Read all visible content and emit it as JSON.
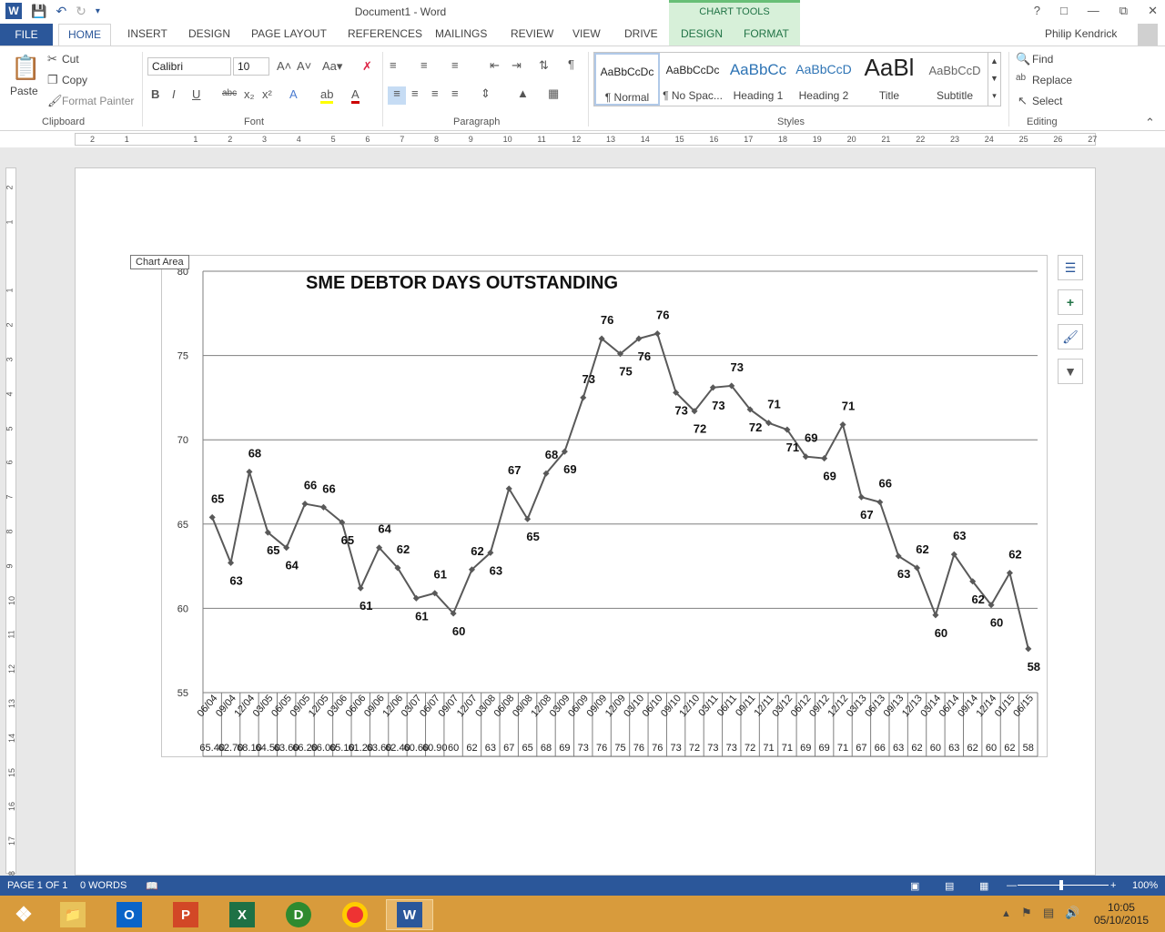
{
  "app": {
    "title": "Document1 - Word",
    "chart_tools": "CHART TOOLS",
    "user": "Philip Kendrick",
    "tabs": [
      "FILE",
      "HOME",
      "INSERT",
      "DESIGN",
      "PAGE LAYOUT",
      "REFERENCES",
      "MAILINGS",
      "REVIEW",
      "VIEW",
      "DRIVE",
      "DESIGN",
      "FORMAT"
    ]
  },
  "ribbon": {
    "clipboard": {
      "label": "Clipboard",
      "paste": "Paste",
      "cut": "Cut",
      "copy": "Copy",
      "format_painter": "Format Painter"
    },
    "font": {
      "label": "Font",
      "name": "Calibri",
      "size": "10"
    },
    "paragraph": {
      "label": "Paragraph"
    },
    "styles": {
      "label": "Styles",
      "items": [
        {
          "sample": "AaBbCcDc",
          "name": "¶ Normal"
        },
        {
          "sample": "AaBbCcDc",
          "name": "¶ No Spac..."
        },
        {
          "sample": "AaBbCc",
          "name": "Heading 1"
        },
        {
          "sample": "AaBbCcD",
          "name": "Heading 2"
        },
        {
          "sample": "AaBl",
          "name": "Title"
        },
        {
          "sample": "AaBbCcD",
          "name": "Subtitle"
        }
      ]
    },
    "editing": {
      "label": "Editing",
      "find": "Find",
      "replace": "Replace",
      "select": "Select"
    }
  },
  "chart_area_tooltip": "Chart Area",
  "chart_data": {
    "type": "line",
    "title": "SME DEBTOR DAYS OUTSTANDING",
    "ylim": [
      55,
      80
    ],
    "yticks": [
      55,
      60,
      65,
      70,
      75,
      80
    ],
    "grid": true,
    "categories": [
      "06/04",
      "09/04",
      "12/04",
      "03/05",
      "06/05",
      "09/05",
      "12/05",
      "03/06",
      "06/06",
      "09/06",
      "12/06",
      "03/07",
      "06/07",
      "09/07",
      "12/07",
      "03/08",
      "06/08",
      "09/08",
      "12/08",
      "03/09",
      "06/09",
      "09/09",
      "12/09",
      "03/10",
      "06/10",
      "09/10",
      "12/10",
      "03/11",
      "06/11",
      "09/11",
      "12/11",
      "03/12",
      "06/12",
      "09/12",
      "12/12",
      "03/13",
      "06/13",
      "09/13",
      "12/13",
      "03/14",
      "06/14",
      "09/14",
      "12/14",
      "01/15",
      "06/15"
    ],
    "values": [
      65.4,
      62.7,
      68.1,
      64.5,
      63.6,
      66.2,
      66.0,
      65.1,
      61.2,
      63.6,
      62.4,
      60.6,
      60.9,
      59.7,
      62.3,
      63.3,
      67.1,
      65.3,
      68.0,
      69.3,
      72.5,
      76.0,
      75.1,
      76.0,
      76.3,
      72.8,
      71.7,
      73.1,
      73.2,
      71.8,
      71.0,
      70.6,
      69.0,
      68.9,
      70.9,
      66.6,
      66.3,
      63.1,
      62.4,
      59.6,
      63.2,
      61.6,
      60.2,
      62.1,
      57.6
    ],
    "data_labels": [
      "65",
      "63",
      "68",
      "65",
      "64",
      "66",
      "66",
      "65",
      "61",
      "64",
      "62",
      "61",
      "61",
      "60",
      "62",
      "63",
      "67",
      "65",
      "68",
      "69",
      "73",
      "76",
      "75",
      "76",
      "76",
      "73",
      "72",
      "73",
      "73",
      "72",
      "71",
      "71",
      "69",
      "69",
      "71",
      "67",
      "66",
      "63",
      "62",
      "60",
      "63",
      "62",
      "60",
      "62",
      "58"
    ],
    "table_row": [
      "65.40",
      "62.70",
      "68.10",
      "64.50",
      "63.60",
      "66.20",
      "66.00",
      "65.10",
      "61.20",
      "63.60",
      "62.40",
      "60.60",
      "60.90",
      "60",
      "62",
      "63",
      "67",
      "65",
      "68",
      "69",
      "73",
      "76",
      "75",
      "76",
      "76",
      "73",
      "72",
      "73",
      "73",
      "72",
      "71",
      "71",
      "69",
      "69",
      "71",
      "67",
      "66",
      "63",
      "62",
      "60",
      "63",
      "62",
      "60",
      "62",
      "58"
    ]
  },
  "status": {
    "page": "PAGE 1 OF 1",
    "words": "0 WORDS",
    "zoom": "100%"
  },
  "clock": {
    "time": "10:05",
    "date": "05/10/2015"
  }
}
